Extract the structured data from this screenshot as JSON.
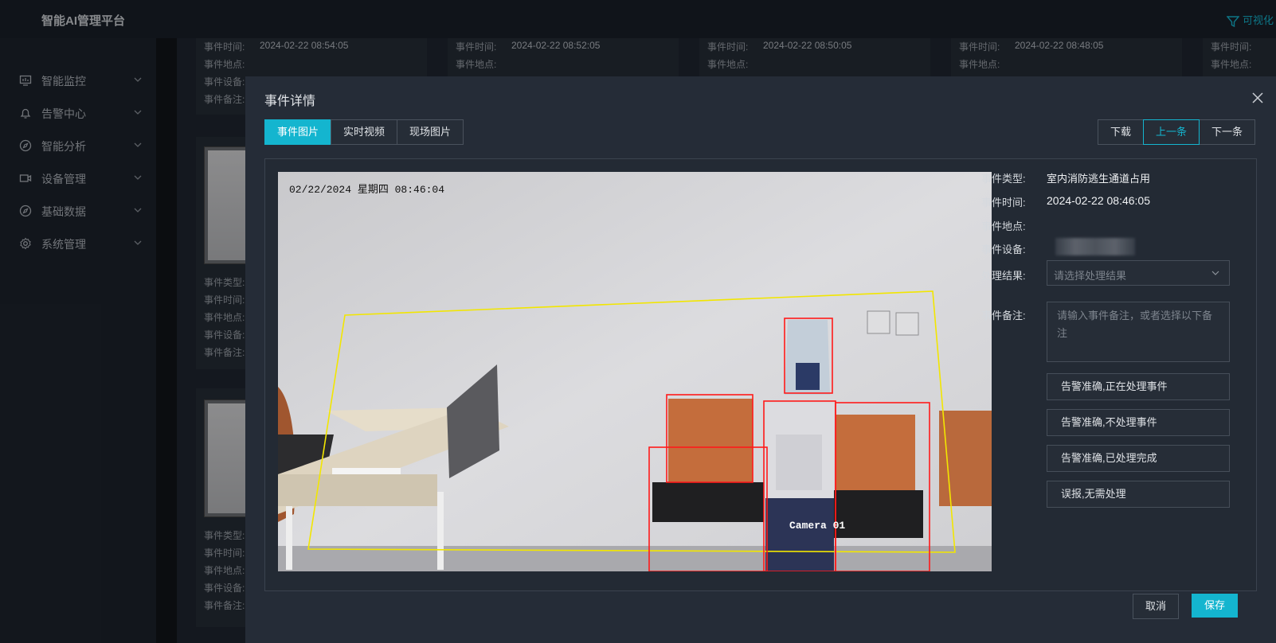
{
  "app": {
    "brand": "智能AI管理平台",
    "top_right_label": "可视化",
    "accent_color": "#14b5cf"
  },
  "sidebar": {
    "items": [
      {
        "label": "智能监控",
        "icon": "monitor-icon"
      },
      {
        "label": "告警中心",
        "icon": "bell-icon"
      },
      {
        "label": "智能分析",
        "icon": "compass-icon"
      },
      {
        "label": "设备管理",
        "icon": "camera-icon"
      },
      {
        "label": "基础数据",
        "icon": "compass-icon"
      },
      {
        "label": "系统管理",
        "icon": "gear-icon"
      }
    ]
  },
  "bg_cards": {
    "labels": {
      "type": "事件类型:",
      "time": "事件时间:",
      "location": "事件地点:",
      "device": "事件设备:",
      "note": "事件备注:"
    },
    "times": [
      "2024-02-22 08:54:05",
      "2024-02-22 08:52:05",
      "2024-02-22 08:50:05",
      "2024-02-22 08:48:05"
    ]
  },
  "modal": {
    "title": "事件详情",
    "tabs": [
      "事件图片",
      "实时视频",
      "现场图片"
    ],
    "actions": {
      "download": "下载",
      "prev": "上一条",
      "next": "下一条"
    },
    "photo": {
      "timestamp": "02/22/2024 星期四 08:46:04",
      "camera_label": "Camera 01"
    },
    "info": {
      "type_label": "事件类型:",
      "type_value": "室内消防逃生通道占用",
      "time_label": "事件时间:",
      "time_value": "2024-02-22 08:46:05",
      "location_label": "事件地点:",
      "device_label": "事件设备:",
      "result_label": "处理结果:",
      "result_placeholder": "请选择处理结果",
      "note_label": "事件备注:",
      "note_placeholder": "请输入事件备注，或者选择以下备注"
    },
    "quick_notes": [
      "告警准确,正在处理事件",
      "告警准确,不处理事件",
      "告警准确,已处理完成",
      "误报,无需处理"
    ],
    "cancel": "取消",
    "save": "保存"
  }
}
